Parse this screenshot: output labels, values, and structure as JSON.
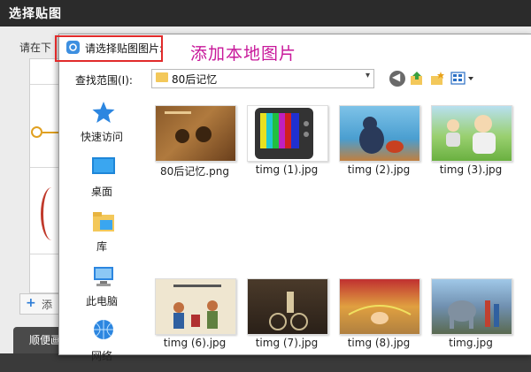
{
  "app": {
    "title": "选择贴图",
    "hint": "请在下",
    "add_label": "添",
    "tab_label": "顺便画"
  },
  "dialog": {
    "title": "请选择贴图图片:",
    "annotation": "添加本地图片",
    "look_in_label": "查找范围(I):",
    "look_in_value": "80后记忆",
    "places": [
      {
        "label": "快速访问",
        "icon": "star-icon"
      },
      {
        "label": "桌面",
        "icon": "desktop-icon"
      },
      {
        "label": "库",
        "icon": "library-icon"
      },
      {
        "label": "此电脑",
        "icon": "computer-icon"
      },
      {
        "label": "网络",
        "icon": "network-icon"
      }
    ],
    "files": [
      {
        "name": "80后记忆.png"
      },
      {
        "name": "timg (1).jpg"
      },
      {
        "name": "timg (2).jpg"
      },
      {
        "name": "timg (3).jpg"
      },
      {
        "name": "timg (6).jpg"
      },
      {
        "name": "timg (7).jpg"
      },
      {
        "name": "timg (8).jpg"
      },
      {
        "name": "timg.jpg"
      }
    ]
  },
  "colors": {
    "highlight": "#e12a2a",
    "annotation": "#c8189a",
    "accent": "#3d8fe0"
  }
}
